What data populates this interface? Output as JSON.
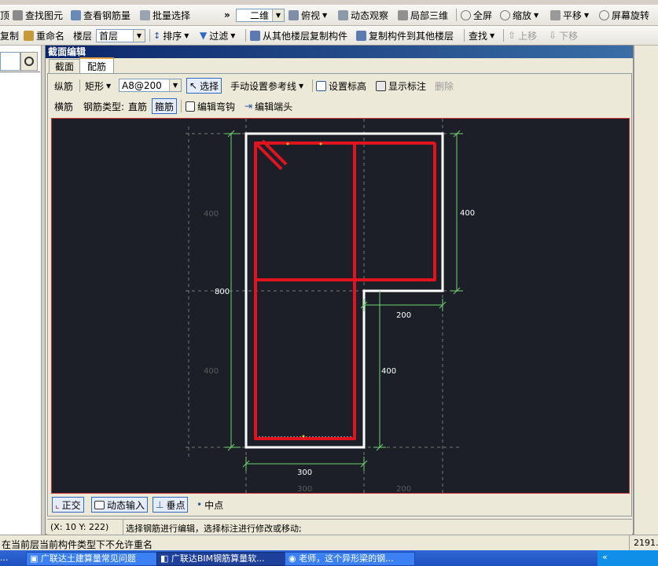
{
  "toolbar1": {
    "items": [
      "顶",
      "查找图元",
      "查看钢筋量",
      "批量选择",
      "二维",
      "俯视",
      "动态观察",
      "局部三维",
      "全屏",
      "缩放",
      "平移",
      "屏幕旋转"
    ],
    "overflow": "»"
  },
  "toolbar2": {
    "copy": "复制",
    "rename": "重命名",
    "floor_label": "楼层",
    "floor_value": "首层",
    "sort": "排序",
    "filter": "过滤",
    "copy_from_other": "从其他楼层复制构件",
    "copy_to_other": "复制构件到其他楼层",
    "find": "查找",
    "move_up": "上移",
    "move_down": "下移"
  },
  "dialog": {
    "title": "截面编辑",
    "tabs": [
      "截面",
      "配筋"
    ],
    "active_tab": "配筋"
  },
  "rebar_toolbar": {
    "longitudinal": "纵筋",
    "shape": "矩形",
    "spec": "A8@200",
    "select": "选择",
    "manual_ref": "手动设置参考线",
    "set_elevation": "设置标高",
    "show_label": "显示标注",
    "delete": "删除"
  },
  "rebar_toolbar2": {
    "horizontal": "横筋",
    "type_label": "钢筋类型:",
    "straight": "直筋",
    "stirrup": "箍筋",
    "edit_bend": "编辑弯钩",
    "edit_end": "编辑端头"
  },
  "dimensions": {
    "left_top": "400",
    "left_mid": "800",
    "left_bottom": "400",
    "right_top": "400",
    "right_step": "200",
    "right_bottom": "400",
    "bottom_width": "300",
    "ghost_bottom_1": "300",
    "ghost_bottom_2": "200"
  },
  "bottom_bar": {
    "ortho": "正交",
    "dynamic_input": "动态输入",
    "perpendicular": "垂点",
    "midpoint": "中点"
  },
  "status": {
    "coords": "(X: 10 Y: 222)",
    "hint": "选择钢筋进行编辑，选择标注进行修改或移动;",
    "message": "在当前层当前构件类型下不允许重名",
    "right_value": "2191."
  },
  "taskbar": {
    "items": [
      "...",
      "广联达土建算量常见问题",
      "广联达BIM钢筋算量软...",
      "老师，这个异形梁的钢..."
    ]
  },
  "colors": {
    "canvas_bg": "#1c1f27",
    "rebar": "#e0141e",
    "outline": "#ffffff",
    "dimension": "#6fd36f",
    "dialog_title": "#0a246a"
  }
}
